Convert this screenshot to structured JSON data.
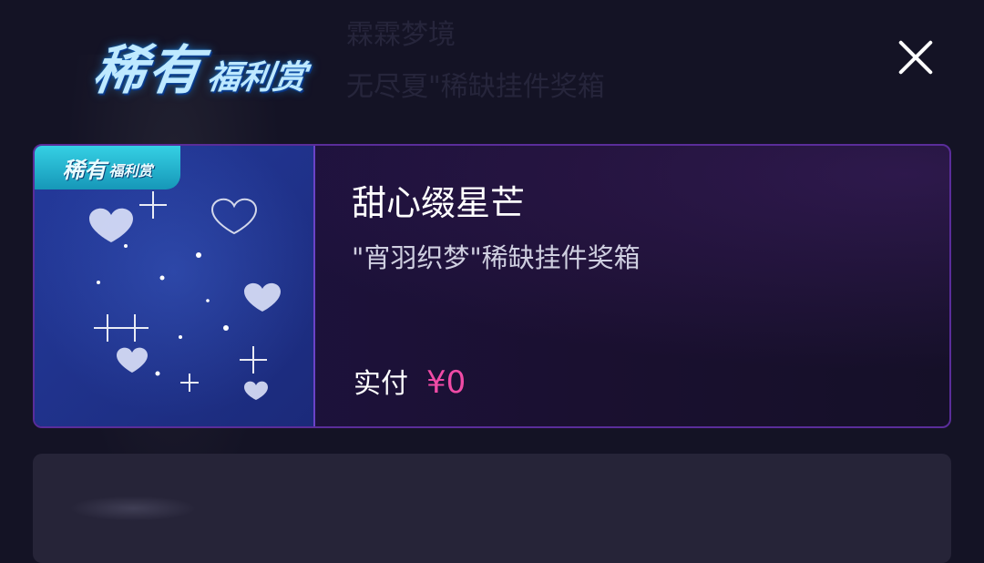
{
  "background": {
    "ghost_lines": [
      "霖霖梦境",
      "无尽夏\"稀缺挂件奖箱"
    ]
  },
  "header": {
    "logo_main": "稀有",
    "logo_sub": "福利赏",
    "close_icon": "close-icon"
  },
  "card": {
    "thumbnail": {
      "badge_main": "稀有",
      "badge_sub": "福利赏",
      "icon": "sparkle-hearts-pendant"
    },
    "title": "甜心缀星芒",
    "subtitle": "\"宵羽织梦\"稀缺挂件奖箱",
    "price_label": "实付",
    "price_value": "¥0"
  },
  "colors": {
    "background": "#141325",
    "card_border": "#5a2d9a",
    "price": "#f04ba6",
    "badge": "#35d0e4"
  }
}
